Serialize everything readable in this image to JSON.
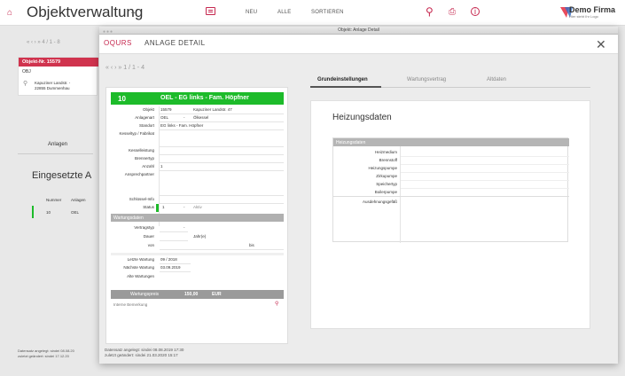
{
  "app": {
    "title": "Objektverwaltung",
    "nav": [
      "NEU",
      "ALLE",
      "SORTIEREN"
    ],
    "logo_name": "Demo Firma",
    "logo_sub": "Hier steht Ihr Logo"
  },
  "background": {
    "pager": "« ‹ › » 4 / 1 - 8",
    "card_badge": "Objekt-Nr.   15579",
    "card_sub": "OBJ",
    "card_addr1": "Kapuziner Landstr. -",
    "card_addr2": "22855 Dummenhau",
    "tab": "Anlagen",
    "heading": "Eingesetzte A",
    "table_head": [
      "Nummer",
      "Anlagen"
    ],
    "table_row": [
      "10",
      "OEL"
    ],
    "foot1_label": "Datensatz angelegt:  sindei",
    "foot1_value": "08.08.20",
    "foot2_label": "zuletzt geändert:  sindei",
    "foot2_value": "17.12.20"
  },
  "window": {
    "titlebar": "Objekt: Anlage Detail",
    "brand": "OQURS",
    "title": "ANLAGE DETAIL",
    "pager": "« ‹ › » 1 / 1 - 4"
  },
  "anlage": {
    "nummer": "10",
    "name": "OEL - EG links - Fam. Höpfner",
    "fields": {
      "objekt_label": "Objekt",
      "objekt": "15579",
      "objekt_addr": "Kapuziner Landstr. 47",
      "anlagenart_label": "Anlagenart",
      "anlagenart": "OEL",
      "anlagenart_desc": "Ölkessel",
      "standort_label": "Standort",
      "standort": "EG links - Fam. Höpfner",
      "kesseltyp_label": "Kesseltyp / Fabrikat",
      "kesselleistung_label": "Kesselleistung",
      "brennertyp_label": "Brennertyp",
      "anzahl_label": "Anzahl",
      "anzahl": "1",
      "ansprechpartner_label": "Ansprechpartner",
      "schluessel_label": "Schlüssel-Info",
      "status_label": "Status",
      "status": "1",
      "status_text": "Aktiv"
    },
    "wartung": {
      "section": "Wartungsdaten",
      "vertragstyp_label": "Vertragstyp",
      "dauer_label": "Dauer",
      "dauer_unit": "Jahr(e)",
      "von_label": "von",
      "bis_label": "bis",
      "letzte_label": "Letzte Wartung",
      "letzte": "09 / 2018",
      "naechste_label": "Nächste Wartung",
      "naechste": "03.09.2019",
      "alte_label": "Alte Wartungen",
      "preis_label": "Wartungspreis",
      "preis": "150,00",
      "waehrung": "EUR"
    },
    "bemerkung_placeholder": "Interne Bemerkung",
    "foot1_label": "Datensatz angelegt:  sindei",
    "foot1_value": "08.08.2019 17:30",
    "foot2_label": "zuletzt geändert:   sindei",
    "foot2_value": "21.03.2020 15:17"
  },
  "tabs": [
    "Grundeinstellungen",
    "Wartungsvertrag",
    "Altdaten"
  ],
  "heizung": {
    "heading": "Heizungsdaten",
    "section": "Heizungsdaten",
    "labels": [
      "Heizmedium",
      "Brennstoff",
      "Heizungspumpe",
      "Zirkupumpe",
      "Speichertyp",
      "Boilerpumpe"
    ],
    "ausdehnung_label": "Ausdehnungsgefäß"
  },
  "colors": {
    "accent": "#c6284f",
    "green": "#1dbb2a"
  }
}
